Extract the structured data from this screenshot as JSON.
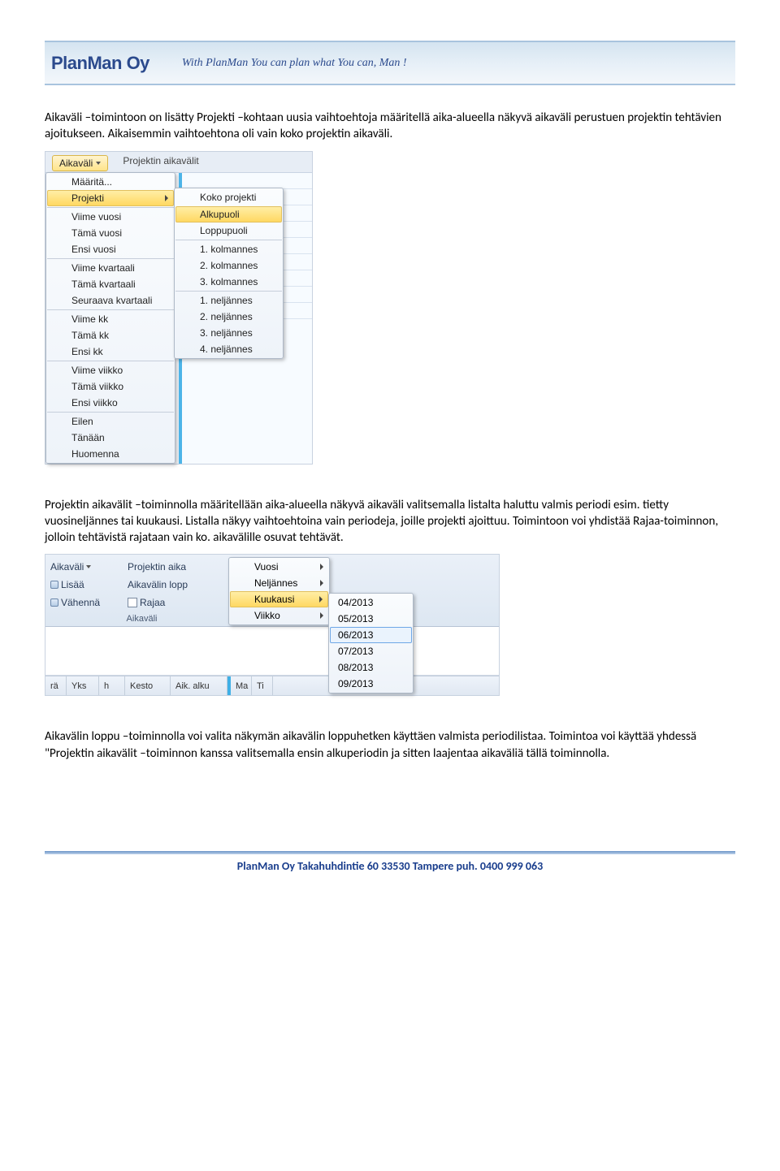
{
  "header": {
    "logo": "PlanMan Oy",
    "tagline": "With PlanMan You can plan what You can, Man !"
  },
  "para1": "Aikaväli –toimintoon on lisätty Projekti –kohtaan uusia vaihtoehtoja määritellä aika-alueella näkyvä aikaväli perustuen projektin tehtävien ajoitukseen. Aikaisemmin vaihtoehtona oli vain koko projektin aikaväli.",
  "shot1": {
    "btn": "Aikaväli",
    "toplabel": "Projektin aikavälit",
    "dd1": [
      {
        "t": "Määritä..."
      },
      {
        "t": "Projekti",
        "hl": true,
        "arrow": true,
        "sep": false
      },
      {
        "t": "Viime vuosi",
        "sep": true
      },
      {
        "t": "Tämä vuosi"
      },
      {
        "t": "Ensi vuosi"
      },
      {
        "t": "Viime kvartaali",
        "sep": true
      },
      {
        "t": "Tämä kvartaali"
      },
      {
        "t": "Seuraava kvartaali"
      },
      {
        "t": "Viime kk",
        "sep": true
      },
      {
        "t": "Tämä kk"
      },
      {
        "t": "Ensi kk"
      },
      {
        "t": "Viime viikko",
        "sep": true
      },
      {
        "t": "Tämä viikko"
      },
      {
        "t": "Ensi viikko"
      },
      {
        "t": "Eilen",
        "sep": true
      },
      {
        "t": "Tänään"
      },
      {
        "t": "Huomenna"
      }
    ],
    "dd2": [
      {
        "t": "Koko projekti"
      },
      {
        "t": "Alkupuoli",
        "hl": true,
        "sep": true
      },
      {
        "t": "Loppupuoli"
      },
      {
        "t": "1. kolmannes",
        "sep": true
      },
      {
        "t": "2. kolmannes"
      },
      {
        "t": "3. kolmannes"
      },
      {
        "t": "1. neljännes",
        "sep": true
      },
      {
        "t": "2. neljännes"
      },
      {
        "t": "3. neljännes"
      },
      {
        "t": "4. neljännes"
      }
    ]
  },
  "para2": "Projektin aikavälit –toiminnolla määritellään aika-alueella näkyvä aikaväli valitsemalla listalta haluttu valmis periodi esim. tietty vuosineljännes tai kuukausi. Listalla näkyy vaihtoehtoina vain periodeja, joille projekti ajoittuu. Toimintoon voi yhdistää Rajaa-toiminnon, jolloin tehtävistä rajataan vain ko. aikavälille osuvat tehtävät.",
  "shot2": {
    "tb": {
      "aikavali": "Aikaväli",
      "projektin": "Projektin aika",
      "lisaa": "Lisää",
      "aikavalin": "Aikavälin lopp",
      "vahenna": "Vähennä",
      "rajaa": "Rajaa",
      "group": "Aikaväli"
    },
    "sub": [
      {
        "t": "Vuosi",
        "arrow": true
      },
      {
        "t": "Neljännes",
        "arrow": true
      },
      {
        "t": "Kuukausi",
        "arrow": true,
        "hl": true
      },
      {
        "t": "Viikko",
        "arrow": true
      }
    ],
    "months": [
      "04/2013",
      "05/2013",
      "06/2013",
      "07/2013",
      "08/2013",
      "09/2013"
    ],
    "month_hl_index": 2,
    "cols": [
      "rä",
      "Yks",
      "h",
      "Kesto",
      "Aik. alku",
      "Ma",
      "Ti"
    ]
  },
  "para3": "Aikavälin loppu –toiminnolla voi valita näkymän aikavälin loppuhetken käyttäen valmista periodilistaa. Toimintoa voi käyttää yhdessä \"Projektin aikavälit –toiminnon kanssa valitsemalla ensin alkuperiodin ja sitten laajentaa aikaväliä tällä toiminnolla.",
  "footer": "PlanMan Oy   Takahuhdintie 60   33530 Tampere   puh. 0400 999 063"
}
